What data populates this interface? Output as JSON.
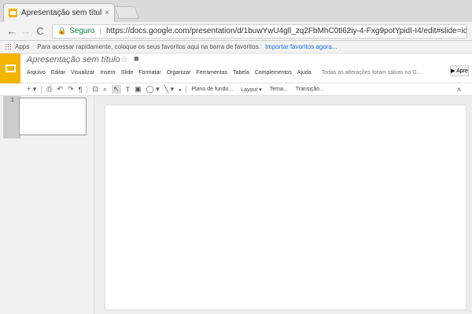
{
  "browser": {
    "tab_title": "Apresentação sem título",
    "tab_close": "×",
    "secure_label": "Seguro",
    "url": "https://docs.google.com/presentation/d/1buwYwU4gll_zq2FbMhC0tl62iy-4-Fxg9potYpidI-I4/edit#slide=id.p",
    "back_icon": "←",
    "forward_icon": "→",
    "reload_icon": "C"
  },
  "bookmarks": {
    "apps_label": "Apps",
    "prompt": "Para acessar rapidamente, coloque os seus favoritos aqui na barra de favoritos.",
    "import_link": "Importar favoritos agora..."
  },
  "docs": {
    "title": "Apresentação sem título",
    "menu": [
      "Arquivo",
      "Editar",
      "Visualizar",
      "Inserir",
      "Slide",
      "Formatar",
      "Organizar",
      "Ferramentas",
      "Tabela",
      "Complementos",
      "Ajuda"
    ],
    "saved_status": "Todas as alterações foram salvas no G...",
    "present_label": "▶ Apre",
    "accent_color": "#f4b400"
  },
  "toolbar": {
    "background_label": "Plano de fundo...",
    "layout_label": "Layout ▾",
    "theme_label": "Tema...",
    "transition_label": "Transição..."
  },
  "slides": {
    "current_number": "1"
  }
}
